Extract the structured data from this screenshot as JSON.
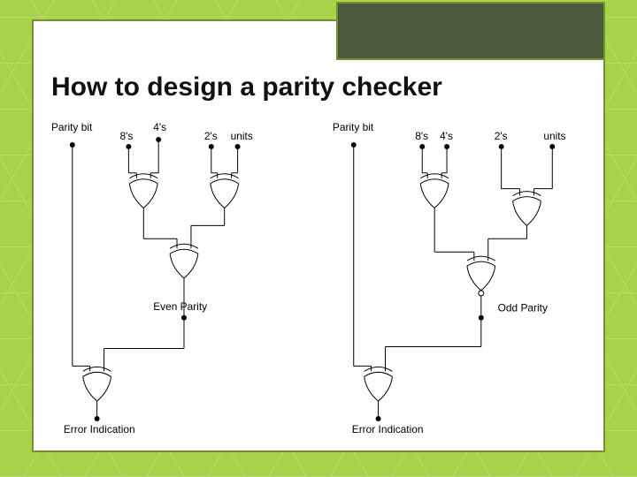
{
  "title": "How to design a parity checker",
  "left": {
    "inputs": {
      "parity": "Parity bit",
      "b8": "8's",
      "b4": "4's",
      "b2": "2's",
      "b1": "units"
    },
    "mid_label": "Even Parity",
    "out_label": "Error Indication",
    "gates": {
      "g1": "XOR",
      "g2": "XOR",
      "g3": "XOR",
      "g4": "XOR"
    }
  },
  "right": {
    "inputs": {
      "parity": "Parity bit",
      "b8": "8's",
      "b4": "4's",
      "b2": "2's",
      "b1": "units"
    },
    "mid_label": "Odd Parity",
    "out_label": "Error Indication",
    "gates": {
      "g1": "XOR",
      "g2": "XOR",
      "g3": "XNOR",
      "g4": "XOR"
    }
  },
  "icons": {
    "xor": "xor-gate-icon",
    "xnor": "xnor-gate-icon",
    "terminal": "terminal-dot-icon"
  }
}
